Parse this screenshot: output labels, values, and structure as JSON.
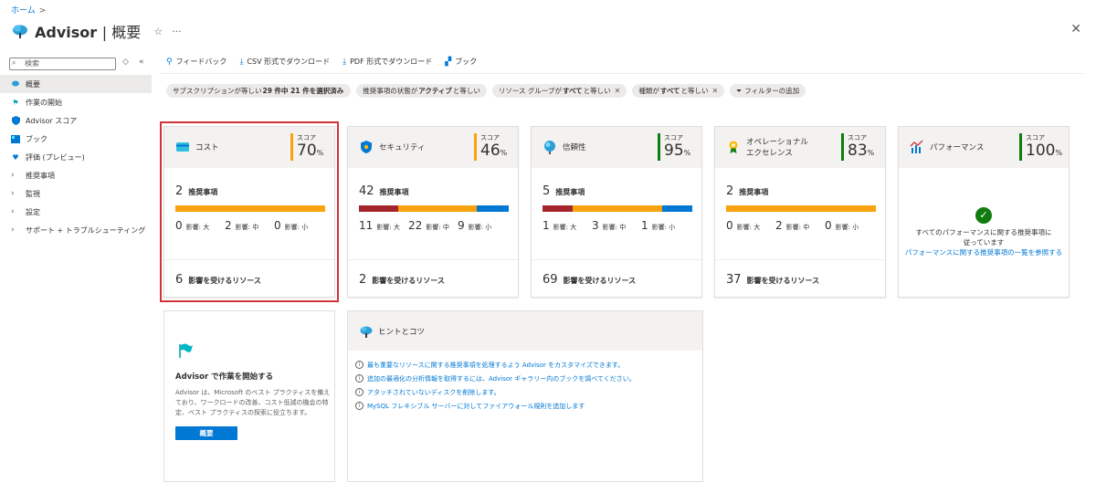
{
  "breadcrumb": {
    "home": "ホーム",
    "sep": ">"
  },
  "header": {
    "title": "Advisor",
    "subtitle": "| 概要",
    "pin": "☆",
    "more": "···",
    "close": "✕"
  },
  "sidebar": {
    "search_placeholder": "検索",
    "items": [
      {
        "label": "概要",
        "icon": "advisor-icon",
        "active": true
      },
      {
        "label": "作業の開始",
        "icon": "flag-icon"
      },
      {
        "label": "Advisor スコア",
        "icon": "shield-icon"
      },
      {
        "label": "ブック",
        "icon": "book-icon"
      },
      {
        "label": "評価 (プレビュー)",
        "icon": "heart-icon"
      },
      {
        "label": "推奨事項",
        "expandable": true
      },
      {
        "label": "監視",
        "expandable": true
      },
      {
        "label": "設定",
        "expandable": true
      },
      {
        "label": "サポート + トラブルシューティング",
        "expandable": true
      }
    ]
  },
  "toolbar": {
    "feedback": "フィードバック",
    "csv": "CSV 形式でダウンロード",
    "pdf": "PDF 形式でダウンロード",
    "book": "ブック"
  },
  "filters": [
    {
      "prefix": "サブスクリプションが等しい ",
      "bold": "29 件中 21 件を選択済み",
      "suffix": "",
      "closable": false
    },
    {
      "prefix": "推奨事項の状態が ",
      "bold": "アクティブ",
      "suffix": " と等しい",
      "closable": false
    },
    {
      "prefix": "リソース グループが ",
      "bold": "すべて",
      "suffix": " と等しい",
      "closable": true
    },
    {
      "prefix": "種類が ",
      "bold": "すべて",
      "suffix": " と等しい",
      "closable": true
    },
    {
      "prefix": "",
      "bold": "",
      "suffix": "フィルターの追加",
      "closable": false,
      "add": true
    }
  ],
  "labels": {
    "score": "スコア",
    "recommendations": "推奨事項",
    "high": "影響: 大",
    "medium": "影響: 中",
    "low": "影響: 小",
    "affected": "影響を受けるリソース",
    "percent": "%"
  },
  "cards": [
    {
      "name": "コスト",
      "score": "70",
      "score_color": "#f7a30f",
      "recs": "2",
      "high": "0",
      "medium": "2",
      "low": "0",
      "affected": "6",
      "bar": [
        0,
        1,
        0
      ]
    },
    {
      "name": "セキュリティ",
      "score": "46",
      "score_color": "#f7a30f",
      "recs": "42",
      "high": "11",
      "medium": "22",
      "low": "9",
      "affected": "2",
      "bar": [
        11,
        22,
        9
      ]
    },
    {
      "name": "信頼性",
      "score": "95",
      "score_color": "#107c10",
      "recs": "5",
      "high": "1",
      "medium": "3",
      "low": "1",
      "affected": "69",
      "bar": [
        1,
        3,
        1
      ]
    },
    {
      "name": "オペレーショナル エクセレンス",
      "score": "83",
      "score_color": "#107c10",
      "recs": "2",
      "high": "0",
      "medium": "2",
      "low": "0",
      "affected": "37",
      "bar": [
        0,
        1,
        0
      ]
    },
    {
      "name": "パフォーマンス",
      "score": "100",
      "score_color": "#107c10",
      "perf_msg": "すべてのパフォーマンスに関する推奨事項に従っています",
      "perf_link": "パフォーマンスに関する推奨事項の一覧を参照する"
    }
  ],
  "colors": {
    "high": "#a4262c",
    "medium": "#f7a30f",
    "low": "#0078d4"
  },
  "getstarted": {
    "title": "Advisor で作業を開始する",
    "desc": "Advisor は、Microsoft のベスト プラクティスを備えており、ワークロードの改善、コスト低減の機会の特定、ベスト プラクティスの探索に役立ちます。",
    "button": "概要"
  },
  "tips": {
    "title": "ヒントとコツ",
    "items": [
      "最も重要なリソースに関する推奨事項を処理するよう Advisor をカスタマイズできます。",
      "追加の最適化の分析情報を取得するには、Advisor ギャラリー内のブックを調べてください。",
      "アタッチされていないディスクを削除します。",
      "MySQL フレキシブル サーバーに対してファイアウォール規則を追加します"
    ]
  }
}
